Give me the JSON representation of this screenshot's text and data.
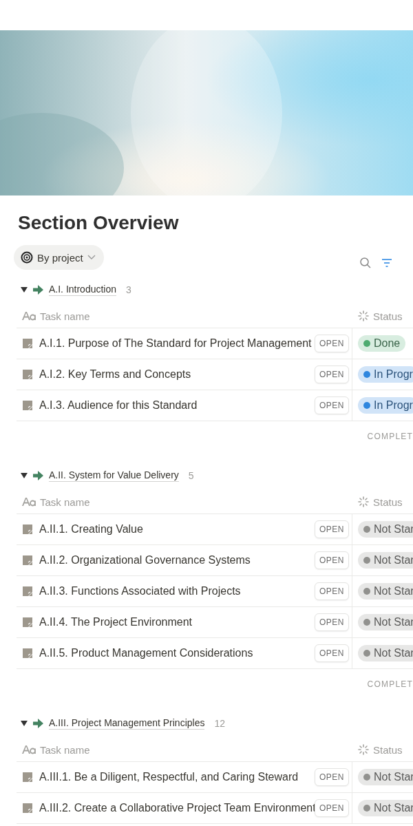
{
  "title": "Section Overview",
  "view": {
    "label": "By project"
  },
  "groups": [
    {
      "name": "A.I. Introduction",
      "count": "3",
      "columns": [
        "Task name",
        "Status"
      ],
      "footer": "COMPLET",
      "tasks": [
        {
          "name": "A.I.1. Purpose of The Standard for Project Management",
          "action": "OPEN",
          "status": {
            "label": "Done",
            "color": "#4dab70"
          }
        },
        {
          "name": "A.I.2. Key Terms and Concepts",
          "action": "OPEN",
          "status": {
            "label": "In Progr",
            "color": "#2e86de"
          }
        },
        {
          "name": "A.I.3. Audience for this Standard",
          "action": "OPEN",
          "status": {
            "label": "In Progr",
            "color": "#2e86de"
          }
        }
      ]
    },
    {
      "name": "A.II. System for Value Delivery",
      "count": "5",
      "columns": [
        "Task name",
        "Status"
      ],
      "footer": "COMPLET",
      "tasks": [
        {
          "name": "A.II.1. Creating Value",
          "action": "OPEN",
          "status": {
            "label": "Not Star",
            "color": "#91918e"
          }
        },
        {
          "name": "A.II.2. Organizational Governance Systems",
          "action": "OPEN",
          "status": {
            "label": "Not Star",
            "color": "#91918e"
          }
        },
        {
          "name": "A.II.3. Functions Associated with Projects",
          "action": "OPEN",
          "status": {
            "label": "Not Star",
            "color": "#91918e"
          }
        },
        {
          "name": "A.II.4. The Project Environment",
          "action": "OPEN",
          "status": {
            "label": "Not Star",
            "color": "#91918e"
          }
        },
        {
          "name": "A.II.5. Product Management Considerations",
          "action": "OPEN",
          "status": {
            "label": "Not Star",
            "color": "#91918e"
          }
        }
      ]
    },
    {
      "name": "A.III. Project Management Principles",
      "count": "12",
      "columns": [
        "Task name",
        "Status"
      ],
      "tasks": [
        {
          "name": "A.III.1. Be a Diligent, Respectful, and Caring Steward",
          "action": "OPEN",
          "status": {
            "label": "Not Star",
            "color": "#91918e"
          }
        },
        {
          "name": "A.III.2. Create a Collaborative Project Team Environment",
          "action": "OPEN",
          "status": {
            "label": "Not Star",
            "color": "#91918e"
          }
        }
      ]
    }
  ]
}
